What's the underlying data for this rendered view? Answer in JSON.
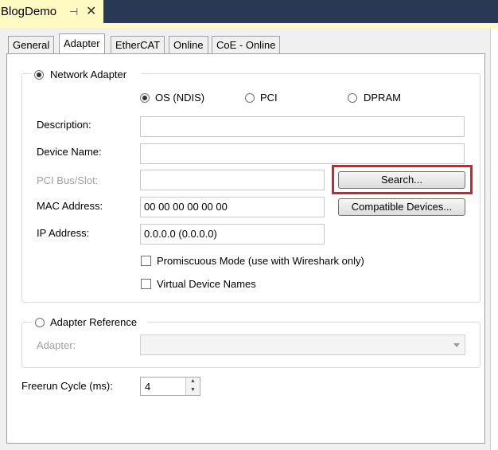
{
  "window": {
    "doc_tab_title": "BlogDemo",
    "pin_glyph": "⊣",
    "close_glyph": "✕"
  },
  "tabs": [
    {
      "label": "General"
    },
    {
      "label": "Adapter"
    },
    {
      "label": "EtherCAT"
    },
    {
      "label": "Online"
    },
    {
      "label": "CoE - Online"
    }
  ],
  "active_tab": "Adapter",
  "network_adapter": {
    "label": "Network Adapter",
    "selected": true,
    "options": [
      {
        "label": "OS (NDIS)",
        "selected": true
      },
      {
        "label": "PCI",
        "selected": false
      },
      {
        "label": "DPRAM",
        "selected": false
      }
    ],
    "description": {
      "label": "Description:",
      "value": ""
    },
    "device_name": {
      "label": "Device Name:",
      "value": ""
    },
    "pci_bus_slot": {
      "label": "PCI Bus/Slot:",
      "value": ""
    },
    "search_button": "Search...",
    "mac_address": {
      "label": "MAC Address:",
      "value": "00 00 00 00 00 00"
    },
    "compatible_button": "Compatible Devices...",
    "ip_address": {
      "label": "IP Address:",
      "value": "0.0.0.0 (0.0.0.0)"
    },
    "promiscuous": {
      "label": "Promiscuous Mode (use with Wireshark only)",
      "checked": false
    },
    "virtual_names": {
      "label": "Virtual Device Names",
      "checked": false
    }
  },
  "adapter_reference": {
    "label": "Adapter Reference",
    "selected": false,
    "adapter_label": "Adapter:",
    "adapter_value": ""
  },
  "freerun": {
    "label": "Freerun Cycle (ms):",
    "value": "4"
  },
  "colors": {
    "highlight": "#e11b2a",
    "doc_tab_bg": "#fff9c2",
    "title_bar": "#293955"
  }
}
